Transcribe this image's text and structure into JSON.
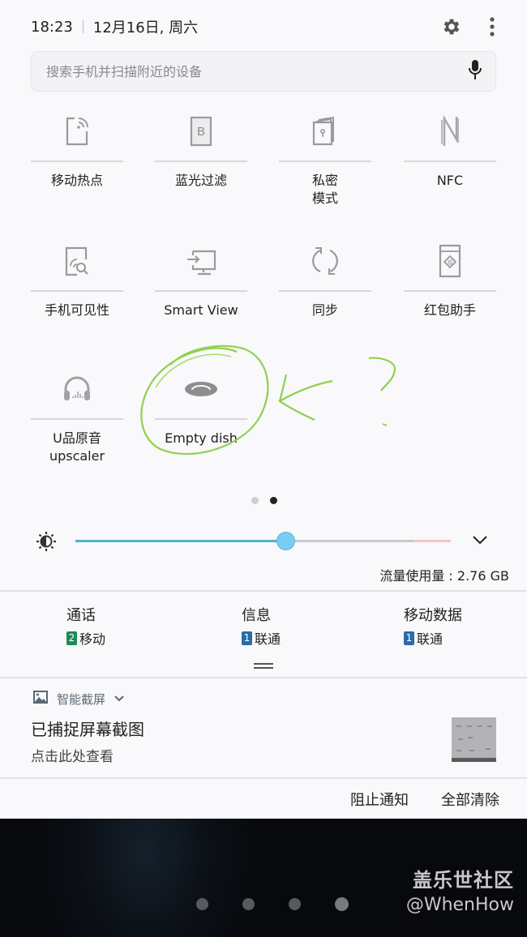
{
  "header": {
    "time": "18:23",
    "date": "12月16日, 周六",
    "icons": [
      "gear-icon",
      "more-vert-icon"
    ]
  },
  "search": {
    "placeholder": "搜索手机并扫描附近的设备",
    "value": "",
    "icon": "microphone-icon"
  },
  "tiles": [
    {
      "label": "移动热点",
      "icon": "mobile-hotspot-icon"
    },
    {
      "label": "蓝光过滤",
      "icon": "blue-light-filter-icon"
    },
    {
      "label": "私密\n模式",
      "icon": "private-mode-icon"
    },
    {
      "label": "NFC",
      "icon": "nfc-icon"
    },
    {
      "label": "手机可见性",
      "icon": "phone-visibility-icon"
    },
    {
      "label": "Smart View",
      "icon": "smart-view-icon"
    },
    {
      "label": "同步",
      "icon": "sync-icon"
    },
    {
      "label": "红包助手",
      "icon": "red-envelope-icon"
    },
    {
      "label": "U品原音\nupscaler",
      "icon": "headphones-icon"
    },
    {
      "label": "Empty dish",
      "icon": "empty-dish-icon"
    }
  ],
  "annotation": {
    "description": "green hand-drawn circle around Empty dish tile with arrow and question mark",
    "color": "#8fd14f",
    "text": "?"
  },
  "pager": {
    "pages": 2,
    "current": 2
  },
  "brightness": {
    "level": 0.56,
    "icon": "brightness-icon",
    "fill_color": "#4fb4c9",
    "thumb_color": "#77cdf2",
    "warning_color": "#f4c7c0"
  },
  "data_usage": "流量使用量 : 2.76 GB",
  "sim": [
    {
      "title": "通话",
      "slot": "2",
      "carrier": "移动",
      "badge_color": "#1e8a55"
    },
    {
      "title": "信息",
      "slot": "1",
      "carrier": "联通",
      "badge_color": "#2a6ca8"
    },
    {
      "title": "移动数据",
      "slot": "1",
      "carrier": "联通",
      "badge_color": "#2a6ca8"
    }
  ],
  "notification": {
    "app_name": "智能截屏",
    "app_icon": "image-icon",
    "title": "已捕捉屏幕截图",
    "subtitle": "点击此处查看"
  },
  "actions": {
    "block": "阻止通知",
    "clear_all": "全部清除"
  },
  "home_pager": {
    "pages": 4,
    "current": 4
  },
  "watermark": {
    "line1": "盖乐世社区",
    "line2": "@WhenHow"
  }
}
